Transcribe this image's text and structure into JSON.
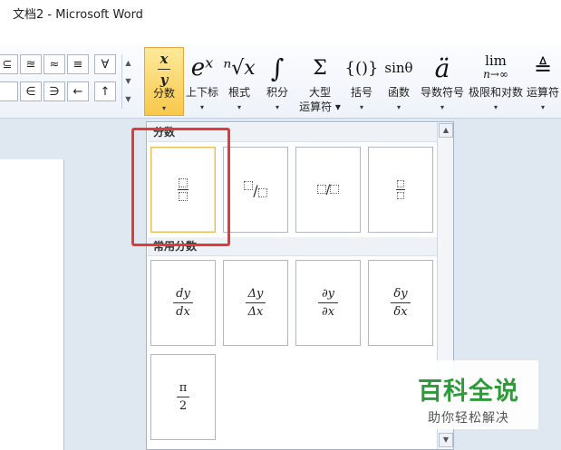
{
  "window": {
    "title": "文档2  -  Microsoft Word"
  },
  "symbols": [
    "⊆",
    "≊",
    "≈",
    "≡",
    "∀",
    "",
    "∈",
    "∋",
    "←",
    "↑"
  ],
  "equation_tools": [
    {
      "id": "fraction",
      "label": "分数",
      "glyph": "x/y"
    },
    {
      "id": "script",
      "label": "上下标",
      "glyph": "eˣ"
    },
    {
      "id": "radical",
      "label": "根式",
      "glyph": "ⁿ√x"
    },
    {
      "id": "integral",
      "label": "积分",
      "glyph": "∫"
    },
    {
      "id": "large-operator",
      "label": "大型",
      "label2": "运算符",
      "glyph": "Σ"
    },
    {
      "id": "bracket",
      "label": "括号",
      "glyph": "{()}"
    },
    {
      "id": "function",
      "label": "函数",
      "glyph": "sinθ"
    },
    {
      "id": "accent",
      "label": "导数符号",
      "glyph": "ä"
    },
    {
      "id": "limit-log",
      "label": "极限和对数",
      "glyph": "lim",
      "glyph2": "n→∞"
    },
    {
      "id": "operator",
      "label": "运算符",
      "glyph": "≜"
    }
  ],
  "gallery": {
    "section1_title": "分数",
    "section2_title": "常用分数",
    "common_fractions": [
      {
        "num": "dy",
        "den": "dx"
      },
      {
        "num": "Δy",
        "den": "Δx"
      },
      {
        "num": "∂y",
        "den": "∂x"
      },
      {
        "num": "δy",
        "den": "δx"
      },
      {
        "num": "π",
        "den": "2"
      }
    ]
  },
  "watermark": {
    "main": "百科全说",
    "sub": "助你轻松解决"
  },
  "colors": {
    "highlight": "#f8c84b",
    "annotation": "#e03a3a",
    "watermark_green": "#2f9a3a"
  }
}
